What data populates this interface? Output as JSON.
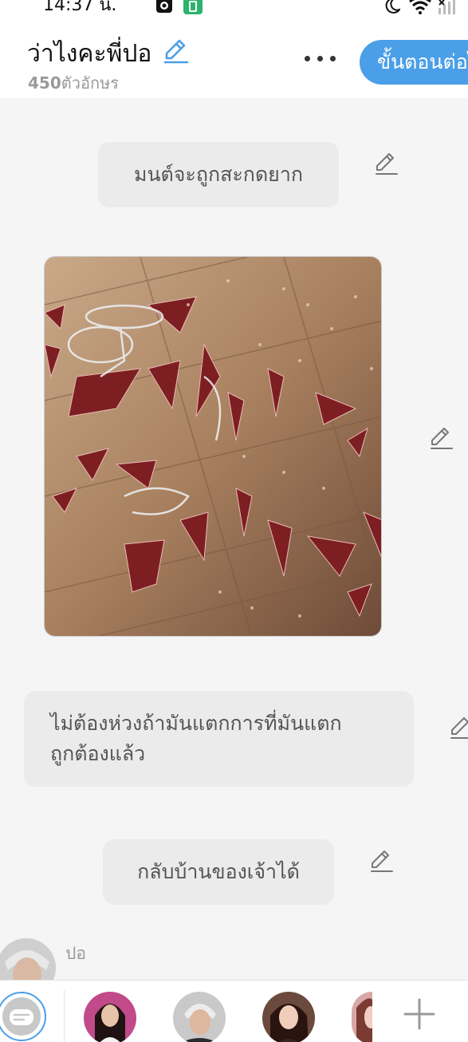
{
  "status_bar": {
    "time": "14:37 น.",
    "icons": [
      "camera-icon",
      "battery-saver-icon",
      "moon-icon",
      "wifi-icon",
      "signal-icon"
    ]
  },
  "header": {
    "title": "ว่าไงคะพี่ปอ",
    "char_count_number": "450",
    "char_count_unit": "ตัวอักษร",
    "more_icon": "more-horizontal-icon",
    "next_button_label": "ขั้นตอนต่อไป"
  },
  "messages": [
    {
      "type": "text",
      "text": "มนต์จะถูกสะกดยาก"
    },
    {
      "type": "image",
      "description_icon": "photo"
    },
    {
      "type": "text",
      "text_line1": "ไม่ต้องห่วงถ้ามันแตกการที่มันแตก",
      "text_line2": "ถูกต้องแล้ว"
    },
    {
      "type": "text",
      "text": "กลับบ้านของเจ้าได้"
    }
  ],
  "sender": {
    "name": "ปอ"
  },
  "bottom_bar": {
    "narration_icon": "narration-icon",
    "characters": [
      "character-1",
      "character-2",
      "character-3",
      "character-4"
    ],
    "add_icon": "plus-icon"
  },
  "colors": {
    "accent": "#4a9fe8",
    "bubble": "#ebebeb",
    "background": "#f5f5f5"
  }
}
